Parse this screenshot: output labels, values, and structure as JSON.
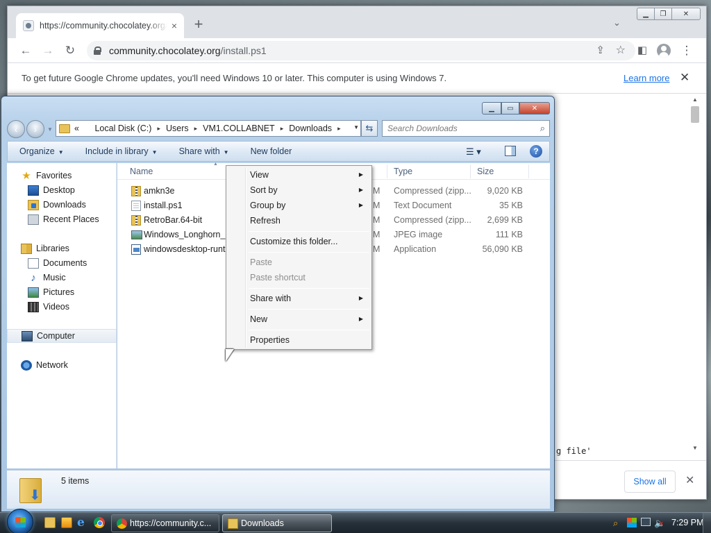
{
  "chrome": {
    "tab_title": "https://community.chocolatey.org/install.ps1",
    "tab_close": "×",
    "new_tab": "+",
    "url_host": "community.chocolatey.org",
    "url_path": "/install.ps1",
    "infobar_message": "To get future Google Chrome updates, you'll need Windows 10 or later. This computer is using Windows 7.",
    "infobar_link": "Learn more",
    "page_code_fragment": "g file'",
    "download_shelf": {
      "show_all": "Show all"
    }
  },
  "explorer": {
    "address": {
      "overflow": "«",
      "crumbs": [
        "Local Disk (C:)",
        "Users",
        "VM1.COLLABNET",
        "Downloads"
      ]
    },
    "search": {
      "placeholder": "Search Downloads"
    },
    "toolbar": {
      "organize": "Organize",
      "include_in_library": "Include in library",
      "share_with": "Share with",
      "new_folder": "New folder",
      "help": "?"
    },
    "navigation": {
      "favorites": "Favorites",
      "favorites_items": [
        "Desktop",
        "Downloads",
        "Recent Places"
      ],
      "libraries": "Libraries",
      "libraries_items": [
        "Documents",
        "Music",
        "Pictures",
        "Videos"
      ],
      "computer": "Computer",
      "network": "Network"
    },
    "columns": {
      "name": "Name",
      "type": "Type",
      "size": "Size"
    },
    "files": [
      {
        "name": "amkn3e",
        "date_fragment": "M",
        "type": "Compressed (zipp...",
        "size": "9,020 KB",
        "icon": "zip-folder-icon"
      },
      {
        "name": "install.ps1",
        "date_fragment": "M",
        "type": "Text Document",
        "size": "35 KB",
        "icon": "text-file-icon"
      },
      {
        "name": "RetroBar.64-bit",
        "date_fragment": "M",
        "type": "Compressed (zipp...",
        "size": "2,699 KB",
        "icon": "zip-folder-icon"
      },
      {
        "name": "Windows_Longhorn_B",
        "date_fragment": "M",
        "type": "JPEG image",
        "size": "111 KB",
        "icon": "image-file-icon"
      },
      {
        "name": "windowsdesktop-runti",
        "date_fragment": "M",
        "type": "Application",
        "size": "56,090 KB",
        "icon": "application-icon"
      }
    ],
    "status": {
      "item_count": "5 items"
    }
  },
  "context_menu": {
    "view": "View",
    "sort_by": "Sort by",
    "group_by": "Group by",
    "refresh": "Refresh",
    "customize": "Customize this folder...",
    "paste": "Paste",
    "paste_shortcut": "Paste shortcut",
    "share_with": "Share with",
    "new": "New",
    "properties": "Properties"
  },
  "taskbar": {
    "chrome_task": "https://community.c...",
    "explorer_task": "Downloads",
    "clock": "7:29 PM"
  }
}
